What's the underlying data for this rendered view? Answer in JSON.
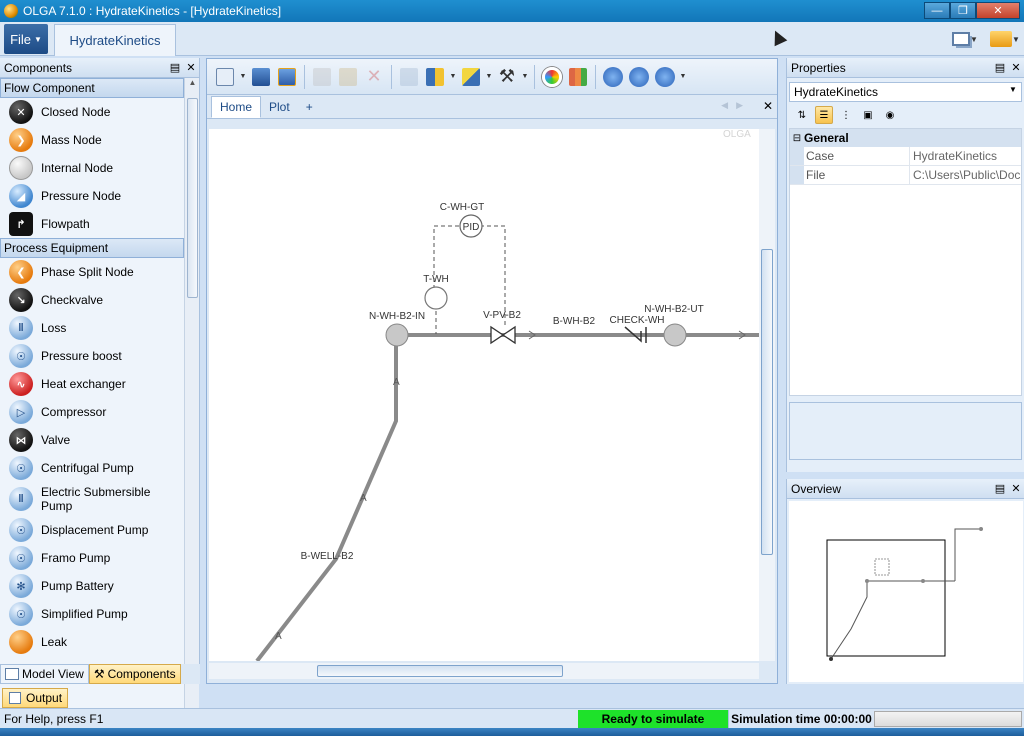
{
  "window": {
    "title": "OLGA 7.1.0 : HydrateKinetics - [HydrateKinetics]"
  },
  "ribbon": {
    "file_label": "File",
    "doc_tab": "HydrateKinetics"
  },
  "components": {
    "title": "Components",
    "categories": [
      {
        "label": "Flow Component",
        "items": [
          "Closed Node",
          "Mass Node",
          "Internal Node",
          "Pressure Node",
          "Flowpath"
        ]
      },
      {
        "label": "Process Equipment",
        "items": [
          "Phase Split Node",
          "Checkvalve",
          "Loss",
          "Pressure boost",
          "Heat exchanger",
          "Compressor",
          "Valve",
          "Centrifugal Pump",
          "Electric Submersible Pump",
          "Displacement Pump",
          "Framo Pump",
          "Pump Battery",
          "Simplified Pump",
          "Leak"
        ]
      }
    ]
  },
  "bottom_tabs": {
    "model_view": "Model View",
    "components": "Components"
  },
  "document": {
    "tabs": {
      "home": "Home",
      "plot": "Plot",
      "add": "+"
    },
    "watermark": "OLGA",
    "diagram_labels": {
      "controller_name": "C-WH-GT",
      "controller_symbol": "PID",
      "transmitter": "T-WH",
      "node_in": "N-WH-B2-IN",
      "valve": "V-PV-B2",
      "branch_wh": "B-WH-B2",
      "checkvalve": "CHECK-WH",
      "node_out": "N-WH-B2-UT",
      "branch_well": "B-WELL-B2",
      "flow_marker": "A"
    },
    "colors": {
      "pipe": "#8a8a8a",
      "node": "#c8c8c8",
      "signal": "#555555"
    }
  },
  "properties": {
    "title": "Properties",
    "object": "HydrateKinetics",
    "category": "General",
    "rows": [
      {
        "key": "Case",
        "value": "HydrateKinetics"
      },
      {
        "key": "File",
        "value": "C:\\Users\\Public\\Docu"
      }
    ]
  },
  "overview": {
    "title": "Overview"
  },
  "output": {
    "label": "Output"
  },
  "status": {
    "help": "For Help, press F1",
    "state": "Ready to simulate",
    "time": "Simulation time 00:00:00"
  }
}
